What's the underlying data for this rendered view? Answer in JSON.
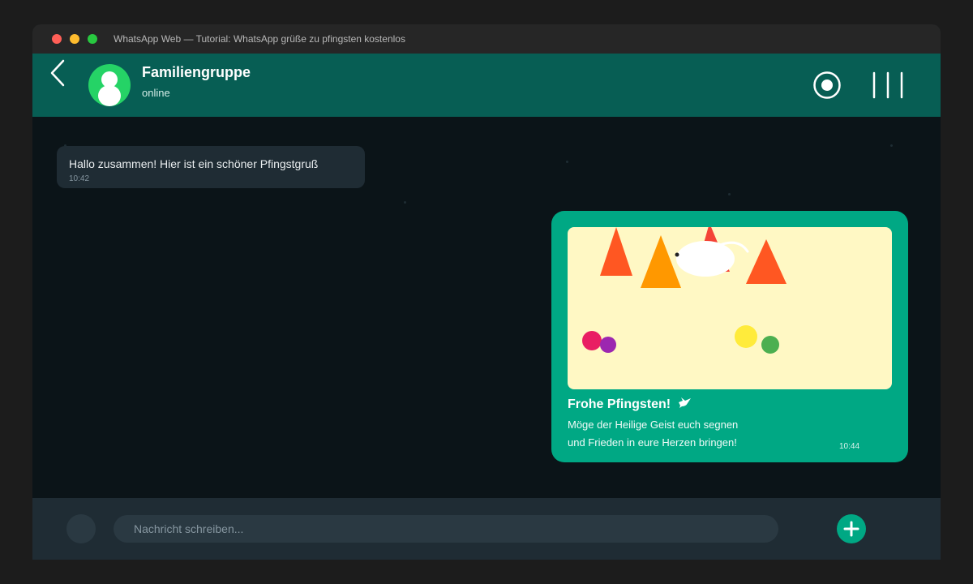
{
  "window": {
    "title": "WhatsApp Web — Tutorial: WhatsApp grüße zu pfingsten kostenlos"
  },
  "header": {
    "contact_name": "Familiengruppe",
    "status": "online",
    "icons": {
      "back": "chevron-left-icon",
      "avatar": "person-icon",
      "record": "record-icon",
      "menu": "menu-bars-icon"
    }
  },
  "messages": [
    {
      "direction": "incoming",
      "text": "Hallo zusammen! Hier ist ein schöner Pfingstgruß",
      "time": "10:42"
    },
    {
      "direction": "outgoing",
      "title": "Frohe Pfingsten!",
      "title_icon": "dove-icon",
      "line1": "Möge der Heilige Geist euch segnen",
      "line2": "und Frieden in eure Herzen bringen!",
      "time": "10:44"
    }
  ],
  "composer": {
    "placeholder": "Nachricht schreiben...",
    "value": "",
    "icons": {
      "emoji": "emoji-icon",
      "add": "plus-icon"
    }
  },
  "colors": {
    "header": "#075e54",
    "accent": "#00a884",
    "incoming_bubble": "#1f2c34",
    "chat_background": "#0b1418",
    "card_background": "#fff8c4"
  }
}
